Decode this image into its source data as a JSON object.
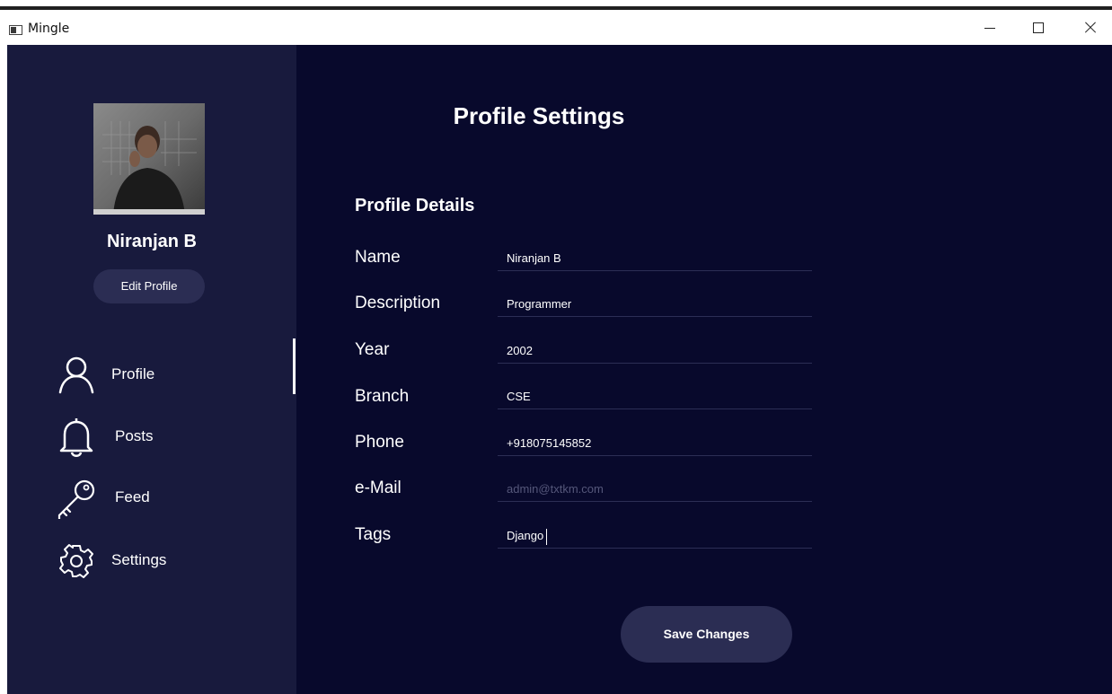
{
  "window": {
    "title": "Mingle"
  },
  "sidebar": {
    "user_name": "Niranjan B",
    "edit_profile_label": "Edit Profile",
    "nav": [
      {
        "label": "Profile",
        "icon": "user-icon",
        "active": true
      },
      {
        "label": "Posts",
        "icon": "bell-icon"
      },
      {
        "label": "Feed",
        "icon": "key-icon"
      },
      {
        "label": "Settings",
        "icon": "gear-icon"
      }
    ]
  },
  "main": {
    "title": "Profile Settings",
    "section_title": "Profile Details",
    "fields": [
      {
        "label": "Name",
        "value": "Niranjan B"
      },
      {
        "label": "Description",
        "value": "Programmer"
      },
      {
        "label": "Year",
        "value": "2002"
      },
      {
        "label": "Branch",
        "value": "CSE"
      },
      {
        "label": "Phone",
        "value": "+918075145852"
      },
      {
        "label": "e-Mail",
        "placeholder": "admin@txtkm.com"
      },
      {
        "label": "Tags",
        "value": "Django"
      }
    ],
    "save_label": "Save Changes"
  },
  "colors": {
    "sidebar_bg": "#181a3d",
    "main_bg": "#08092c",
    "button_bg": "#2b2d53",
    "text": "#ffffff"
  }
}
